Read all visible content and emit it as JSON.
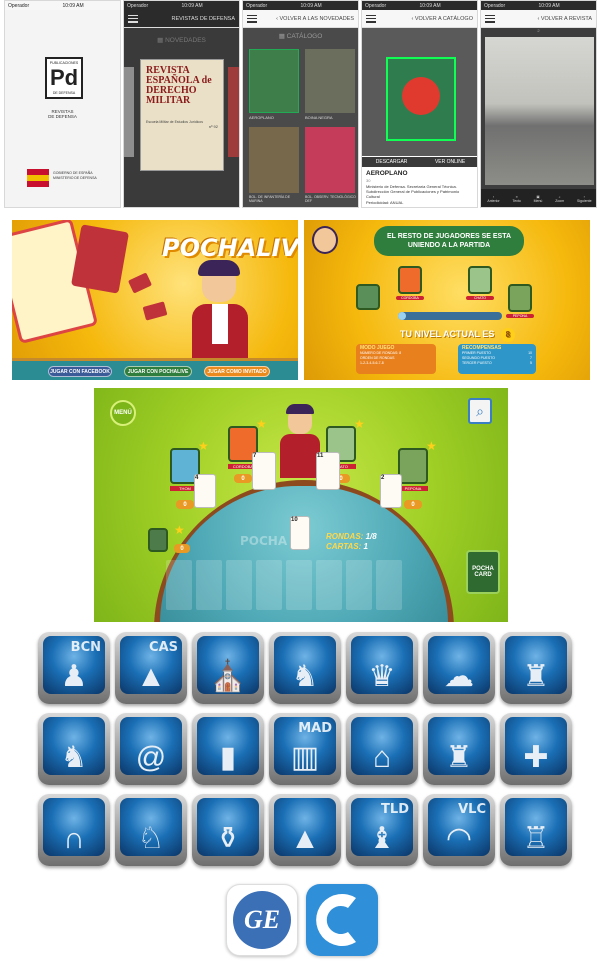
{
  "phones": {
    "status_operator": "Operador",
    "status_time": "10:09 AM",
    "status_time_b": "10:08 AM",
    "status_time_c": "10:09 AM",
    "splash": {
      "logo_top": "PUBLICACIONES",
      "logo_mark": "Pd",
      "logo_bottom": "DE DEFENSA",
      "subtitle": "REVISTAS\nDE DEFENSA",
      "ministry": "GOBIERNO DE ESPAÑA",
      "ministry_b": "MINISTERIO DE DEFENSA"
    },
    "novedades": {
      "nav_title": "REVISTAS DE DEFENSA",
      "section": "NOVEDADES",
      "cover_title": "REVISTA ESPAÑOLA de DERECHO MILITAR",
      "cover_sub": "Escuela Militar de Estudios Jurídicos",
      "cover_num": "nº 92"
    },
    "catalogo": {
      "back": "VOLVER A LAS NOVEDADES",
      "section": "CATÁLOGO",
      "items": [
        {
          "name": "AEROPLANO"
        },
        {
          "name": "BOINA NEGRA"
        },
        {
          "name": "BOL. DE INFANTERÍA DE MARINA"
        },
        {
          "name": "BOL. OBSERV. TECNOLÓGICO DEF"
        }
      ]
    },
    "detalle": {
      "back": "VOLVER A CATÁLOGO",
      "download": "DESCARGAR",
      "view": "VER ONLINE",
      "title": "AEROPLANO",
      "num": "30",
      "desc": "Ministerio de Defensa. Secretaría General Técnica. Subdirección General de Publicaciones y Patrimonio Cultural",
      "period": "Periodicidad: ANUAL"
    },
    "lector": {
      "back": "VOLVER A REVISTA",
      "page": "2",
      "toolbar": [
        "Anterior",
        "Texto",
        "Menú",
        "Zoom",
        "Siguiente"
      ]
    }
  },
  "pocha_intro": {
    "title": "POCHALIVE",
    "buttons": [
      "JUGAR CON FACEBOOK",
      "JUGAR CON POCHALIVE",
      "JUGAR COMO INVITADO"
    ]
  },
  "pocha_wait": {
    "message": "EL RESTO DE JUGADORES SE ESTA UNIENDO A LA PARTIDA",
    "players": [
      "",
      "CORDOBA",
      "CHATO",
      "PEPONA"
    ],
    "level_label": "TU NIVEL ACTUAL ES",
    "level": "8",
    "mode_title": "MODO JUEGO",
    "mode_lines": [
      "NÚMERO DE RONDAS: 8",
      "ORDEN DE RONDAS",
      "1-2-3-4-5-6-7-8"
    ],
    "rewards_title": "RECOMPENSAS",
    "rewards": [
      {
        "label": "PRIMER PUESTO",
        "value": "10"
      },
      {
        "label": "SEGUNDO PUESTO",
        "value": "7"
      },
      {
        "label": "TERCER PUESTO",
        "value": "5"
      }
    ]
  },
  "pocha_table": {
    "menu": "MENÚ",
    "opponents": [
      {
        "name": "THOM",
        "bid": "0",
        "level": "1"
      },
      {
        "name": "CORDOBA",
        "bid": "0",
        "level": "2"
      },
      {
        "name": "CHATO",
        "bid": "0",
        "level": "3"
      },
      {
        "name": "PEPONA",
        "bid": "0",
        "level": "2"
      }
    ],
    "self_bid": "0",
    "self_level": "1",
    "table_label": "POCHA",
    "rounds_label": "RONDAS:",
    "rounds_value": "1/8",
    "cards_label": "CARTAS:",
    "cards_value": "1",
    "played_cards": [
      "4",
      "7",
      "11",
      "2"
    ],
    "hand_card": "10",
    "pocha_card": "POCHA CARD"
  },
  "icons": [
    {
      "label": "BCN",
      "name": "barcelona-icon",
      "glyph": "♟"
    },
    {
      "label": "CAS",
      "name": "castellon-icon",
      "glyph": "▲"
    },
    {
      "label": "",
      "name": "dome-icon",
      "glyph": "⛪"
    },
    {
      "label": "",
      "name": "bull-icon",
      "glyph": "♞"
    },
    {
      "label": "",
      "name": "virgin-icon",
      "glyph": "♛"
    },
    {
      "label": "",
      "name": "shell-roof-icon",
      "glyph": "☁"
    },
    {
      "label": "",
      "name": "statue-icon",
      "glyph": "♜"
    },
    {
      "label": "",
      "name": "lion-icon",
      "glyph": "♞"
    },
    {
      "label": "",
      "name": "snail-icon",
      "glyph": "@"
    },
    {
      "label": "",
      "name": "columns-icon",
      "glyph": "▮"
    },
    {
      "label": "MAD",
      "name": "madrid-icon",
      "glyph": "▥"
    },
    {
      "label": "",
      "name": "palace-icon",
      "glyph": "⌂"
    },
    {
      "label": "",
      "name": "castle-icon",
      "glyph": "♜"
    },
    {
      "label": "",
      "name": "santiago-shell-icon",
      "glyph": "✚"
    },
    {
      "label": "",
      "name": "aqueduct-icon",
      "glyph": "∩"
    },
    {
      "label": "",
      "name": "horse-icon",
      "glyph": "♘"
    },
    {
      "label": "",
      "name": "vase-icon",
      "glyph": "⚱"
    },
    {
      "label": "",
      "name": "pyramid-icon",
      "glyph": "▲"
    },
    {
      "label": "TLD",
      "name": "toledo-icon",
      "glyph": "♝"
    },
    {
      "label": "VLC",
      "name": "valencia-icon",
      "glyph": "◠"
    },
    {
      "label": "",
      "name": "lighthouse-icon",
      "glyph": "♖"
    }
  ],
  "colors": {
    "game_yellow": "#f5b80c",
    "felt_blue": "#4fa9b6",
    "icon_blue": "#1a6fb5",
    "ge_blue": "#3b6fb6"
  },
  "logos": {
    "ge": "GE"
  }
}
